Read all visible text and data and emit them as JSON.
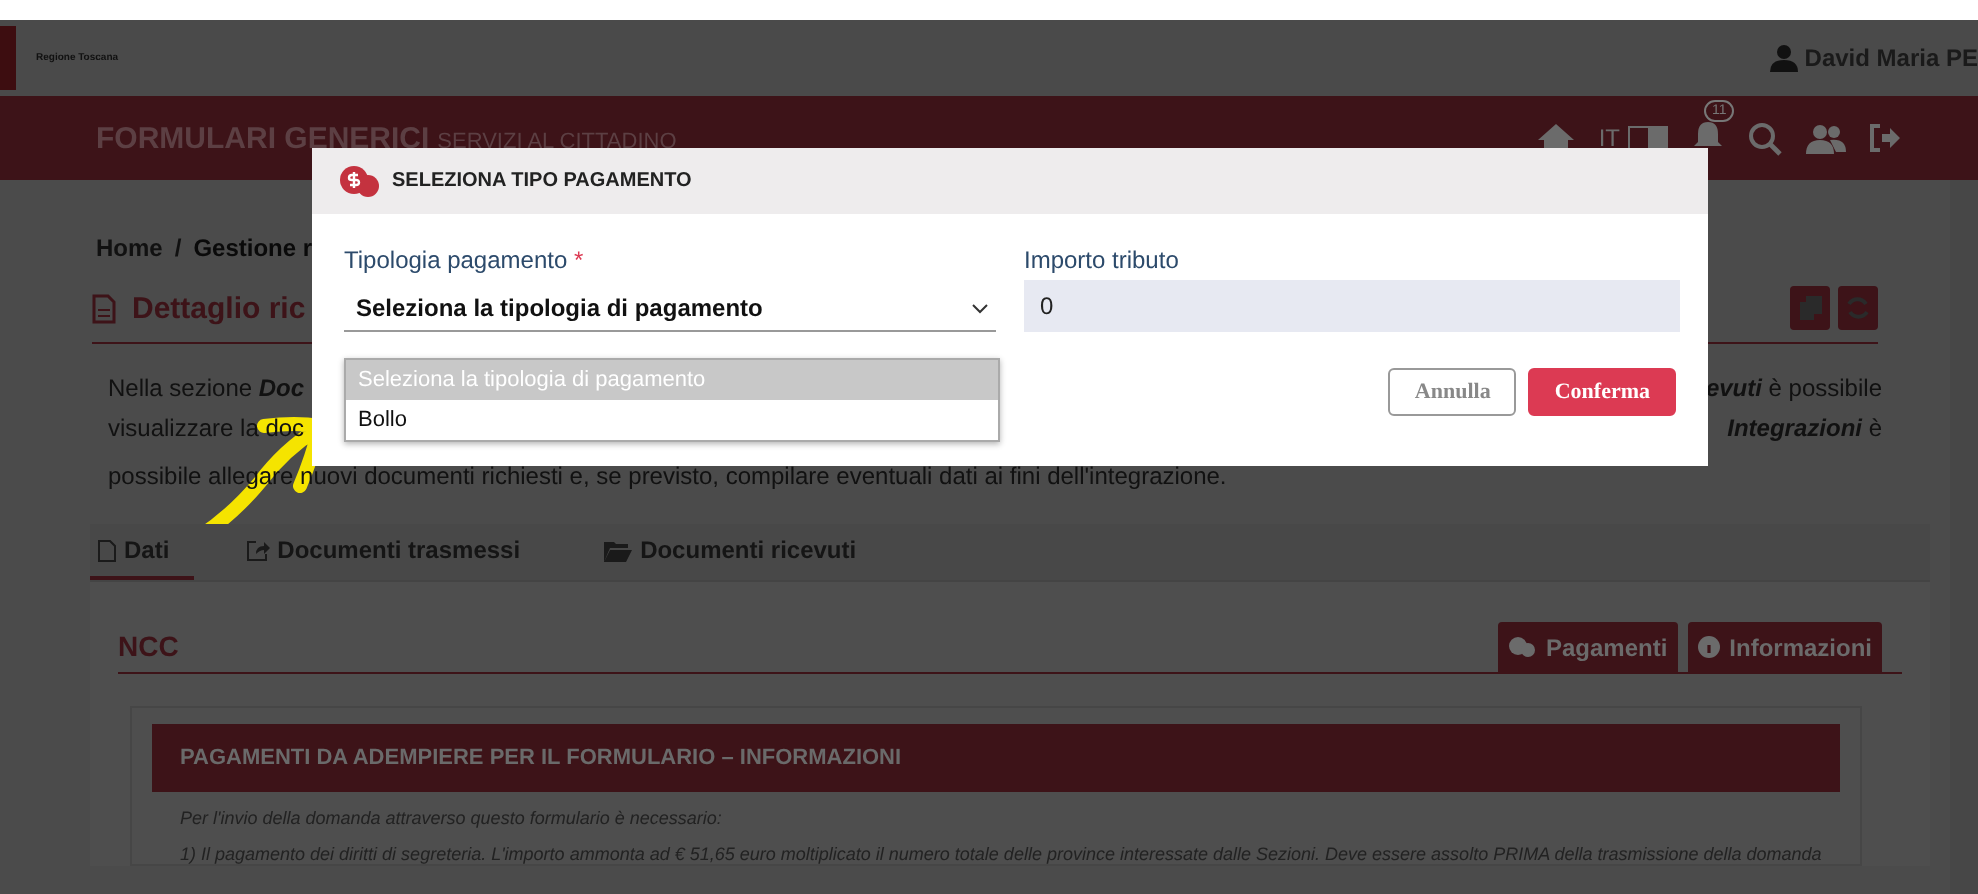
{
  "header": {
    "logo_text": "Regione Toscana",
    "user": "David Maria PE"
  },
  "navbar": {
    "title": "FORMULARI GENERICI",
    "subtitle": "SERVIZI AL CITTADINO",
    "language": "IT",
    "notification_count": "11"
  },
  "breadcrumb": [
    "Home",
    "Gestione r"
  ],
  "breadcrumb_separator": "/",
  "page_title": "Dettaglio ric",
  "intro_lines": [
    {
      "left": "Nella sezione **Doc**",
      "right": "**evuti** è possibile"
    },
    {
      "left": "visualizzare la doc",
      "right": "**Integrazioni** è"
    },
    {
      "left": "possibile allegare nuovi documenti richiesti e, se previsto, compilare eventuali dati ai fini dell'integrazione."
    }
  ],
  "tabs": [
    {
      "label": "Dati",
      "selected": true
    },
    {
      "label": "Documenti trasmessi",
      "selected": false
    },
    {
      "label": "Documenti ricevuti",
      "selected": false
    }
  ],
  "section": {
    "title": "NCC",
    "buttons": [
      "Pagamenti",
      "Informazioni"
    ]
  },
  "panel": {
    "title": "PAGAMENTI DA ADEMPIERE PER IL FORMULARIO – INFORMAZIONI",
    "lines": [
      "Per l'invio della domanda attraverso questo formulario è necessario:",
      "1) Il pagamento dei diritti di segreteria. L'importo ammonta ad € 51,65 euro moltiplicato il numero totale delle province interessate dalle Sezioni. Deve essere assolto PRIMA della trasmissione della domanda"
    ]
  },
  "modal": {
    "title": "SELEZIONA TIPO PAGAMENTO",
    "type_field": {
      "label": "Tipologia pagamento",
      "required_mark": "*",
      "value": "Seleziona la tipologia di pagamento",
      "options": [
        {
          "label": "Seleziona la tipologia di pagamento",
          "selected": true
        },
        {
          "label": "Bollo",
          "selected": false
        }
      ]
    },
    "amount_field": {
      "label": "Importo tributo",
      "value": "0"
    },
    "buttons": [
      "Annulla",
      "Conferma"
    ]
  }
}
